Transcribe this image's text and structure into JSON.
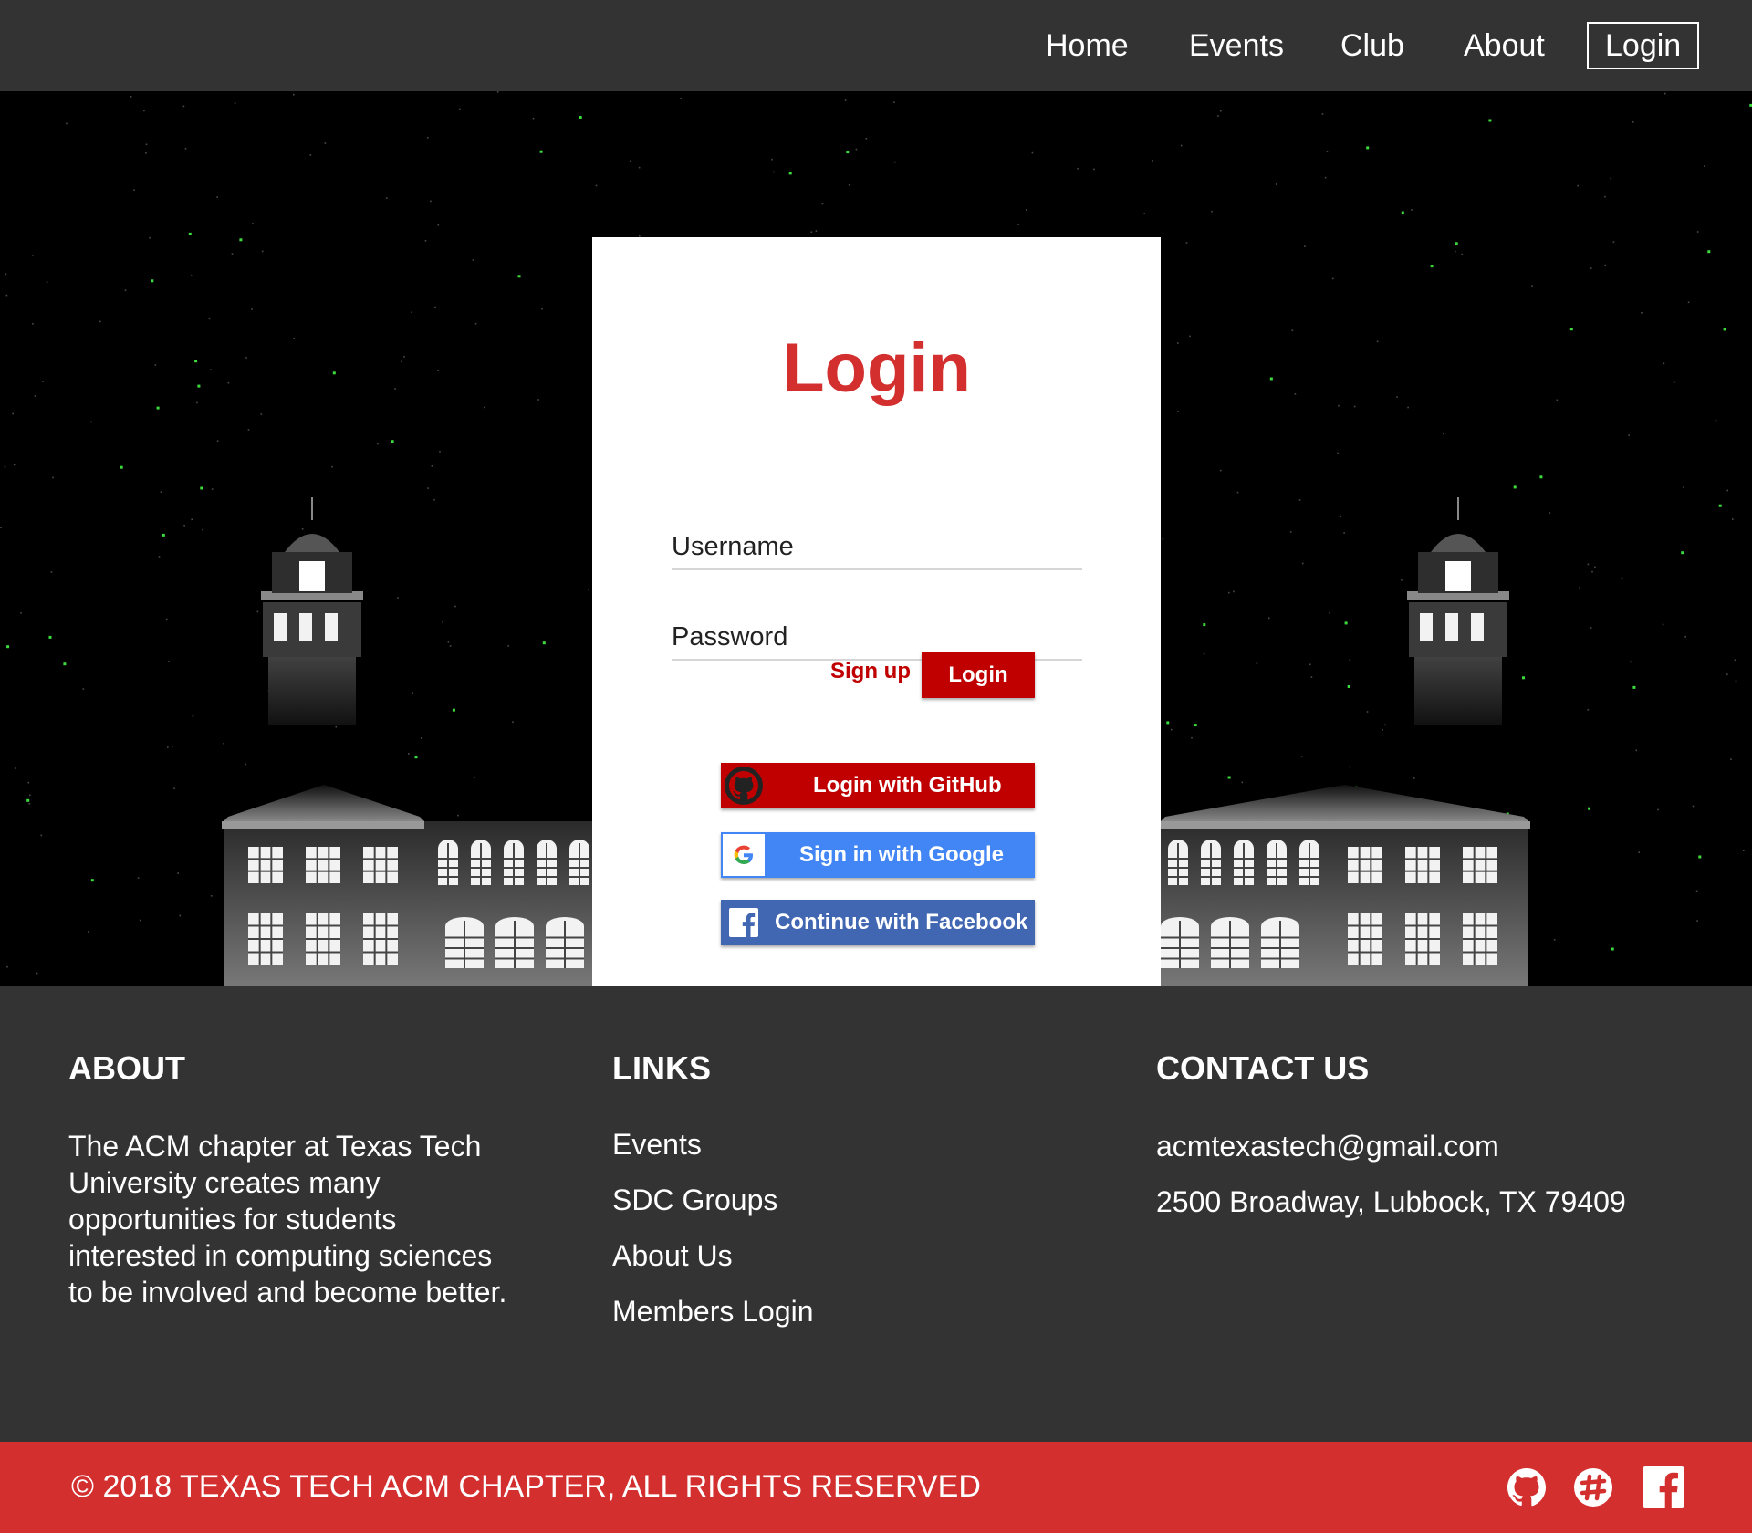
{
  "nav": {
    "items": [
      "Home",
      "Events",
      "Club",
      "About"
    ],
    "login": "Login"
  },
  "login_card": {
    "title": "Login",
    "username_placeholder": "Username",
    "password_placeholder": "Password",
    "signup_label": "Sign up",
    "login_button": "Login",
    "github_button": "Login with GitHub",
    "google_button": "Sign in with Google",
    "facebook_button": "Continue with Facebook"
  },
  "footer": {
    "about": {
      "heading": "ABOUT",
      "lines": [
        "The ACM chapter at Texas Tech",
        "University creates many",
        "opportunities for students",
        "interested in computing sciences",
        "to be involved and become better."
      ]
    },
    "links": {
      "heading": "LINKS",
      "items": [
        "Events",
        "SDC Groups",
        "About Us",
        "Members Login"
      ]
    },
    "contact": {
      "heading": "CONTACT US",
      "email": "acmtexastech@gmail.com",
      "address": "2500 Broadway, Lubbock, TX 79409"
    }
  },
  "bottom_bar": {
    "copyright": "© 2018 TEXAS TECH ACM CHAPTER, ALL RIGHTS RESERVED",
    "social_icons": [
      "github-icon",
      "slack-icon",
      "facebook-icon"
    ]
  },
  "colors": {
    "accent_red": "#d32f2f",
    "button_red": "#c00000",
    "google_blue": "#4285f4",
    "facebook_blue": "#4267b2",
    "dark_bg": "#333333",
    "star_green": "#3ddc3d"
  }
}
